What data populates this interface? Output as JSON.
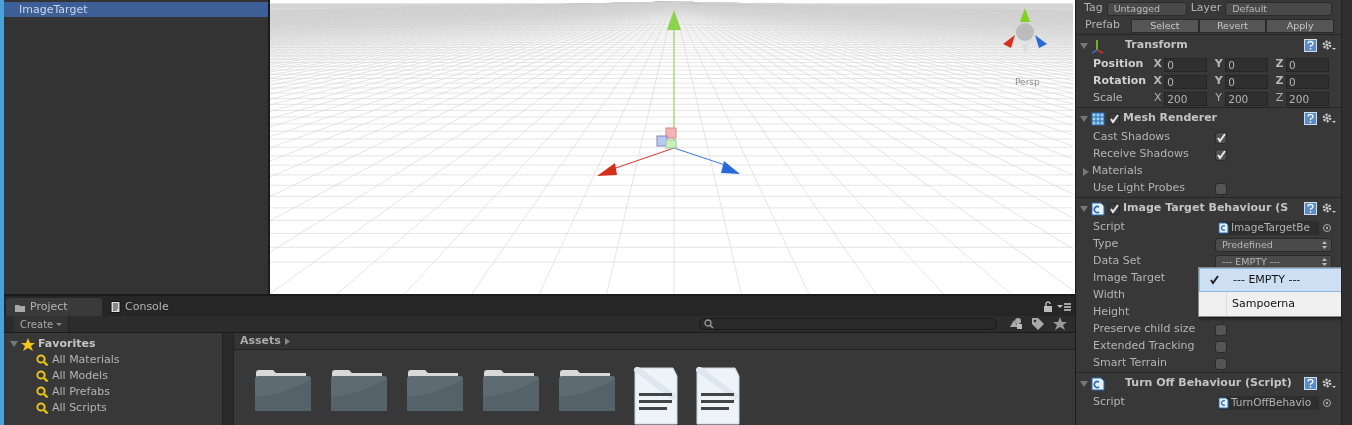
{
  "hierarchy": {
    "items": [
      {
        "label": "ImageTarget",
        "selected": true
      }
    ]
  },
  "scene": {
    "gizmo_label": "Persp"
  },
  "project": {
    "tabs": [
      {
        "label": "Project",
        "selected": true
      },
      {
        "label": "Console",
        "selected": false
      }
    ],
    "create_button": "Create",
    "favorites": {
      "label": "Favorites",
      "expanded": true,
      "children": [
        {
          "label": "All Materials"
        },
        {
          "label": "All Models"
        },
        {
          "label": "All Prefabs"
        },
        {
          "label": "All Scripts"
        }
      ]
    },
    "breadcrumb": "Assets",
    "assets": [
      {
        "kind": "folder"
      },
      {
        "kind": "folder"
      },
      {
        "kind": "folder"
      },
      {
        "kind": "folder"
      },
      {
        "kind": "folder"
      },
      {
        "kind": "document"
      },
      {
        "kind": "document"
      }
    ]
  },
  "inspector": {
    "tag": {
      "label": "Tag",
      "value": "Untagged"
    },
    "layer": {
      "label": "Layer",
      "value": "Default"
    },
    "prefab": {
      "label": "Prefab",
      "buttons": [
        "Select",
        "Revert",
        "Apply"
      ]
    },
    "components": [
      {
        "kind": "transform",
        "title": "Transform",
        "expanded": true,
        "rows": [
          {
            "label": "Position",
            "modified": true,
            "fields": [
              {
                "axis": "X",
                "value": "0"
              },
              {
                "axis": "Y",
                "value": "0"
              },
              {
                "axis": "Z",
                "value": "0"
              }
            ]
          },
          {
            "label": "Rotation",
            "modified": true,
            "fields": [
              {
                "axis": "X",
                "value": "0"
              },
              {
                "axis": "Y",
                "value": "0"
              },
              {
                "axis": "Z",
                "value": "0"
              }
            ]
          },
          {
            "label": "Scale",
            "modified": false,
            "fields": [
              {
                "axis": "X",
                "value": "200"
              },
              {
                "axis": "Y",
                "value": "200"
              },
              {
                "axis": "Z",
                "value": "200"
              }
            ]
          }
        ]
      },
      {
        "kind": "renderer",
        "title": "Mesh Renderer",
        "enabled": true,
        "expanded": true,
        "props": [
          {
            "kind": "checkbox",
            "label": "Cast Shadows",
            "checked": true
          },
          {
            "kind": "checkbox",
            "label": "Receive Shadows",
            "checked": true
          },
          {
            "kind": "foldout",
            "label": "Materials",
            "expanded": false
          },
          {
            "kind": "checkbox",
            "label": "Use Light Probes",
            "checked": false
          }
        ]
      },
      {
        "kind": "script",
        "title": "Image Target Behaviour (S",
        "enabled": true,
        "expanded": true,
        "props": [
          {
            "kind": "object",
            "label": "Script",
            "value": "ImageTargetBe"
          },
          {
            "kind": "dropdown",
            "label": "Type",
            "value": "Predefined"
          },
          {
            "kind": "dropdown",
            "label": "Data Set",
            "value": "--- EMPTY ---"
          },
          {
            "kind": "covered",
            "label": "Image Target"
          },
          {
            "kind": "covered",
            "label": "Width"
          },
          {
            "kind": "covered",
            "label": "Height"
          },
          {
            "kind": "checkbox",
            "label": "Preserve child size",
            "checked": false
          },
          {
            "kind": "checkbox",
            "label": "Extended Tracking",
            "checked": false
          },
          {
            "kind": "checkbox",
            "label": "Smart Terrain",
            "checked": false
          }
        ]
      },
      {
        "kind": "script",
        "title": "Turn Off Behaviour (Script)",
        "expanded": true,
        "props": [
          {
            "kind": "object",
            "label": "Script",
            "value": "TurnOffBehavio"
          }
        ]
      }
    ],
    "popup": {
      "items": [
        {
          "label": "--- EMPTY ---",
          "selected": true
        },
        {
          "label": "Sampoerna",
          "selected": false
        }
      ]
    }
  }
}
